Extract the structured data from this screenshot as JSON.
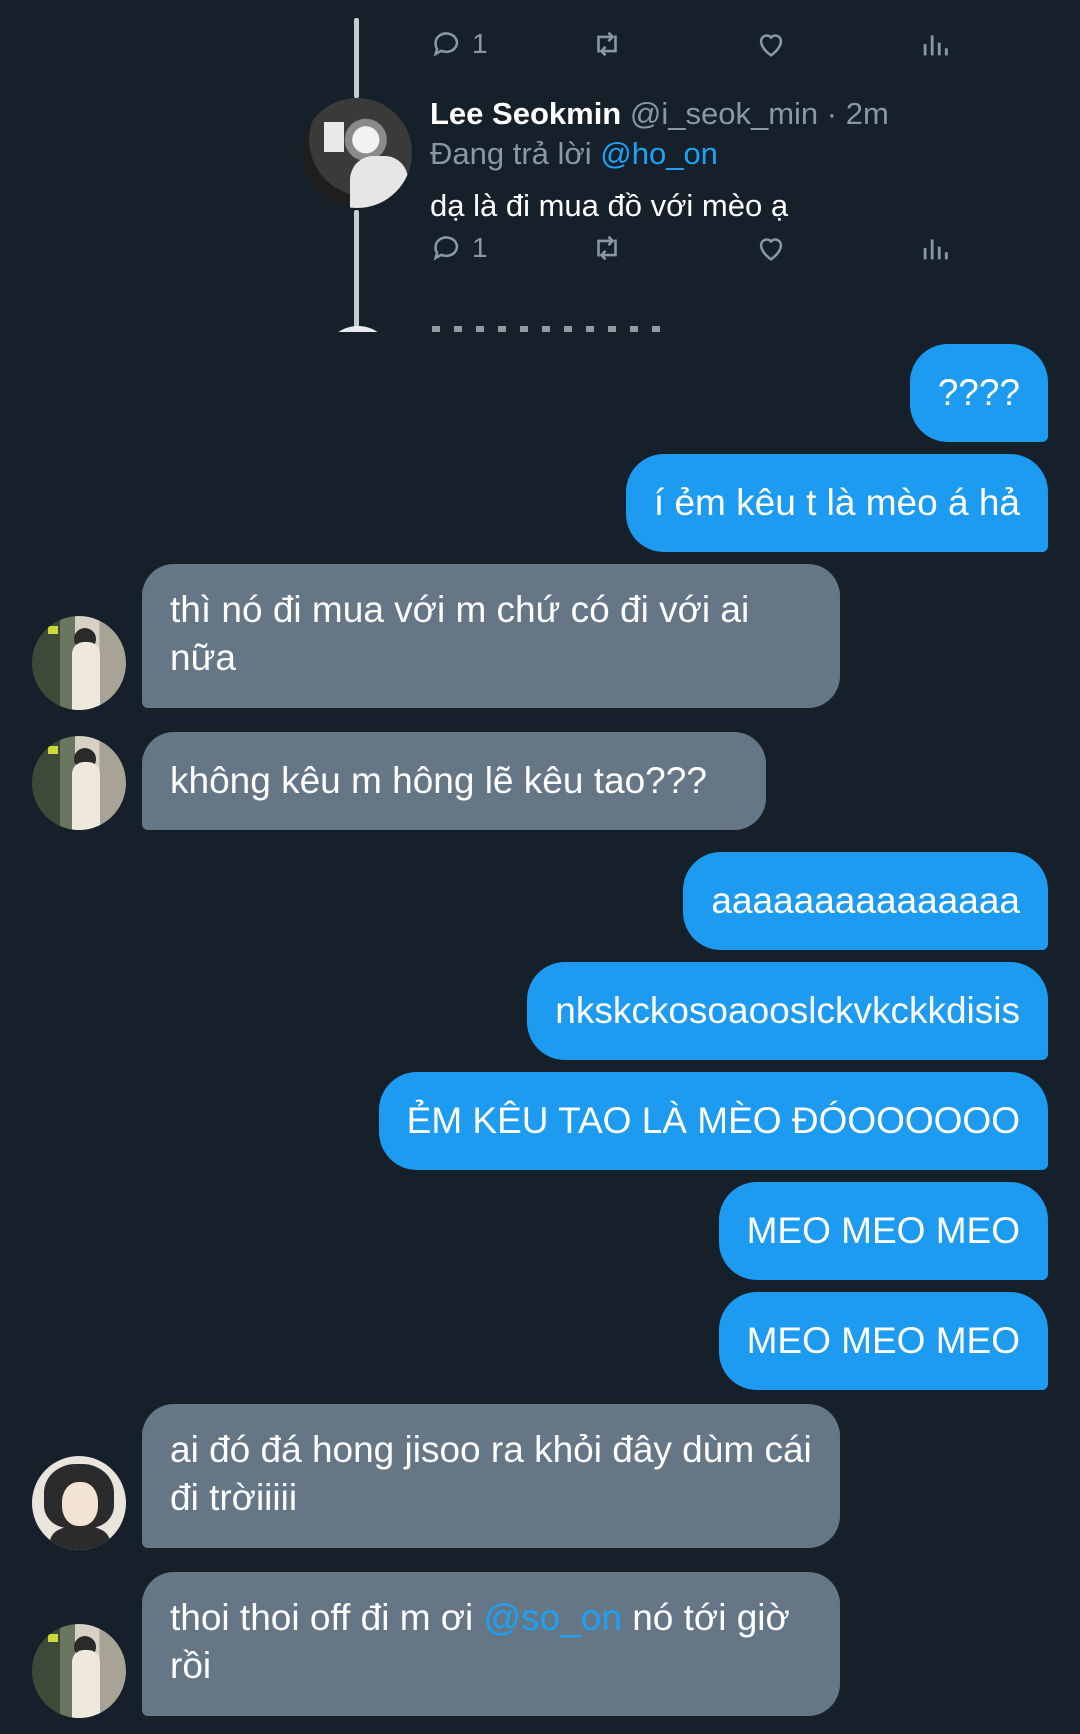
{
  "thread": {
    "top_actions": {
      "reply_count": "1"
    },
    "tweet": {
      "name": "Lee Seokmin",
      "handle": "@i_seok_min",
      "dot": "·",
      "time": "2m",
      "replying_prefix": "Đang trả lời",
      "replying_to": "@ho_on",
      "text": "dạ là đi mua đồ với mèo ạ",
      "reply_count": "1"
    }
  },
  "messages": [
    {
      "side": "sent",
      "text": "????"
    },
    {
      "side": "sent",
      "text": "í ẻm kêu t là mèo á hả"
    },
    {
      "side": "recv",
      "text": "thì nó đi mua với m chứ có đi với ai nữa"
    },
    {
      "side": "recv",
      "text": "không kêu m hông lẽ kêu tao???"
    },
    {
      "side": "sent",
      "text": "aaaaaaaaaaaaaaa"
    },
    {
      "side": "sent",
      "text": "nkskckosoaooslckvkckkdisis"
    },
    {
      "side": "sent",
      "text": "ẺM KÊU TAO LÀ MÈO ĐÓOOOOOO"
    },
    {
      "side": "sent",
      "text": "MEO MEO MEO"
    },
    {
      "side": "sent",
      "text": "MEO MEO MEO"
    },
    {
      "side": "recv",
      "text": "ai đó đá hong jisoo ra khỏi đây dùm cái đi trờiiiii"
    },
    {
      "side": "recv",
      "text_before": "thoi thoi off đi m ơi",
      "mention": "@so_on",
      "text_after": "nó tới giờ rồi"
    }
  ],
  "colors": {
    "background": "#15202b",
    "sent_bubble": "#1d9bf0",
    "received_bubble": "#657786",
    "mention": "#1da1f2",
    "muted": "#8899a6"
  },
  "icons": [
    "reply-icon",
    "retweet-icon",
    "like-icon",
    "stats-icon"
  ]
}
